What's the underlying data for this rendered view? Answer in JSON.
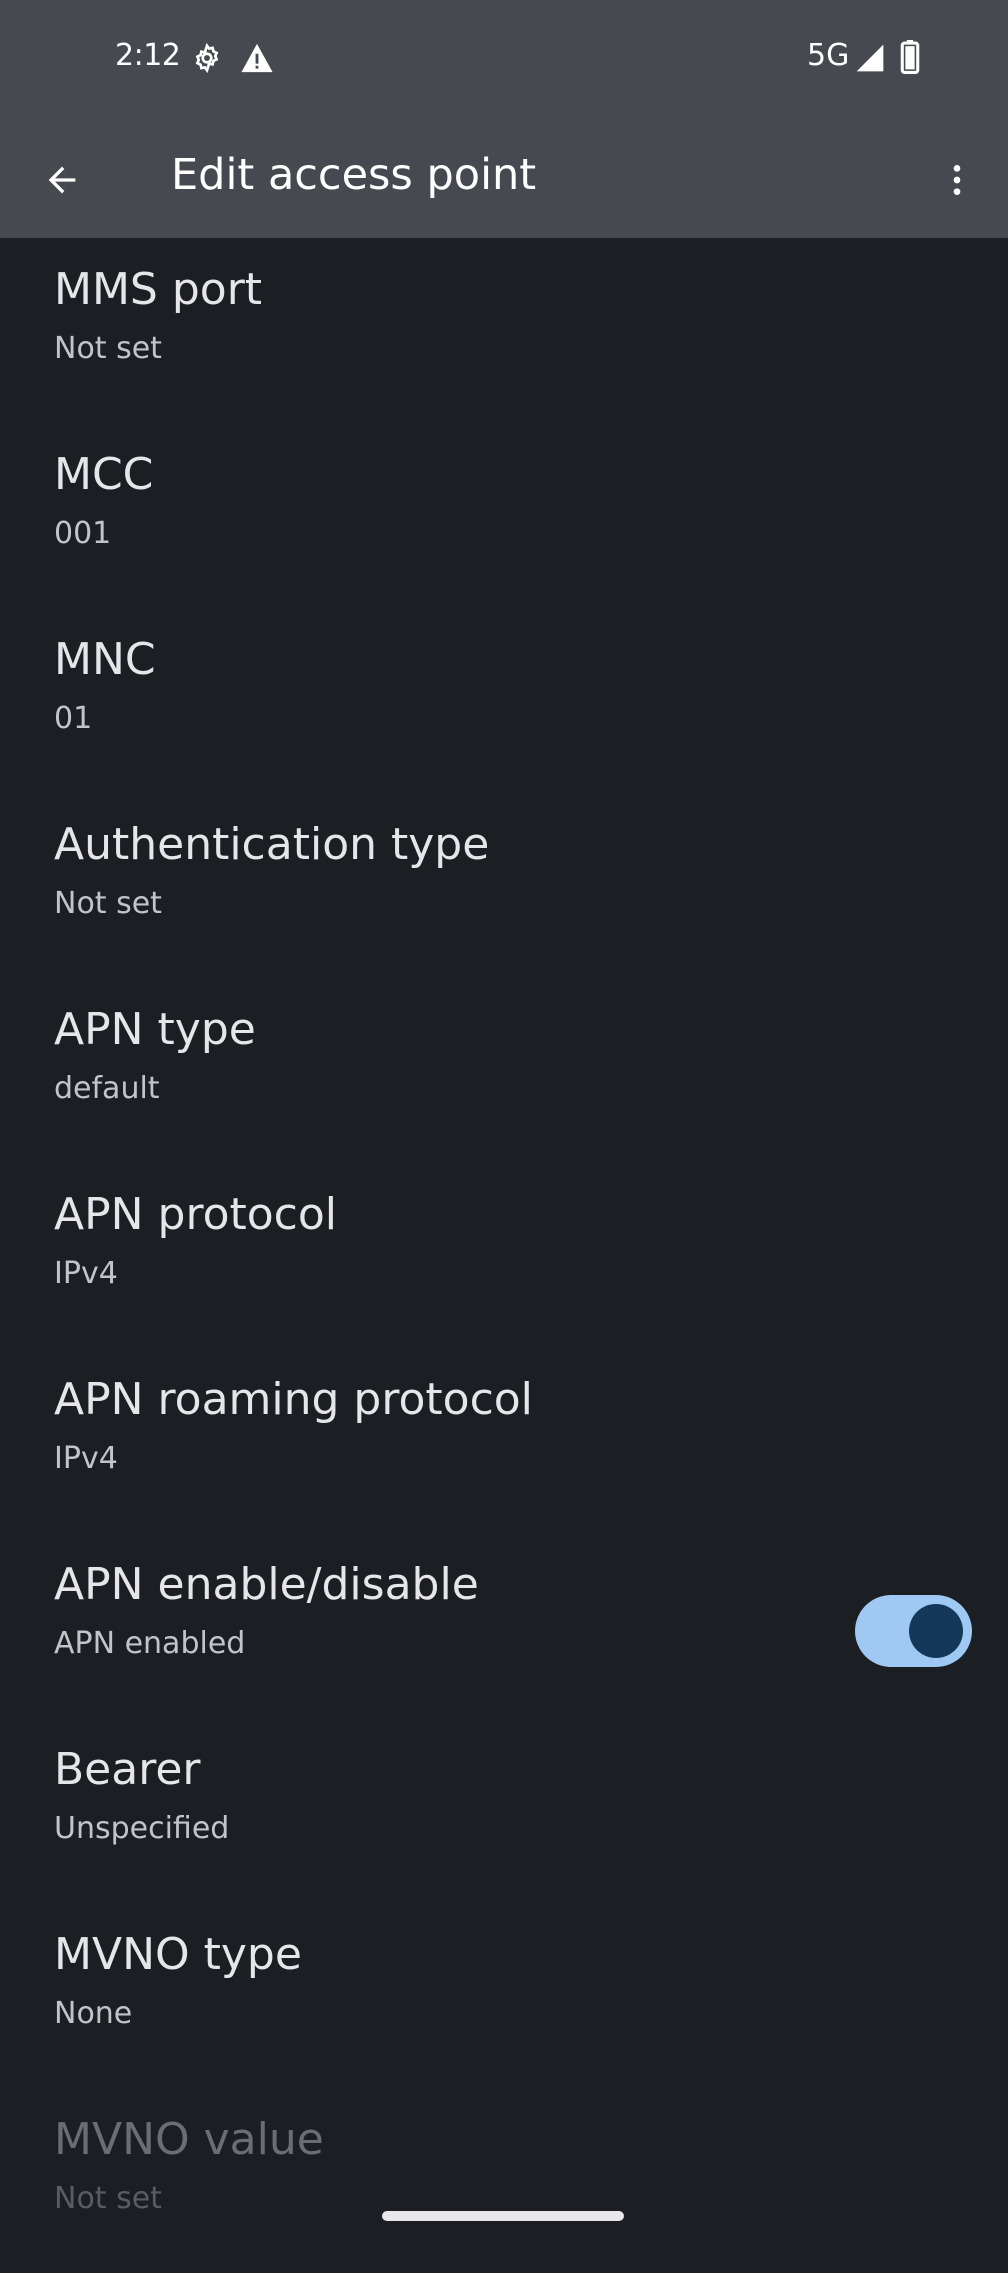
{
  "status_bar": {
    "time": "2:12",
    "network": "5G",
    "icons": [
      "settings-gear-icon",
      "warning-icon",
      "cell-signal-icon",
      "battery-icon"
    ]
  },
  "app_bar": {
    "title": "Edit access point",
    "back_icon": "arrow-back-icon",
    "more_icon": "more-vert-icon"
  },
  "preferences": [
    {
      "title": "MMS port",
      "summary": "Not set"
    },
    {
      "title": "MCC",
      "summary": "001"
    },
    {
      "title": "MNC",
      "summary": "01"
    },
    {
      "title": "Authentication type",
      "summary": "Not set"
    },
    {
      "title": "APN type",
      "summary": "default"
    },
    {
      "title": "APN protocol",
      "summary": "IPv4"
    },
    {
      "title": "APN roaming protocol",
      "summary": "IPv4"
    },
    {
      "title": "APN enable/disable",
      "summary": "APN enabled",
      "toggle_on": true
    },
    {
      "title": "Bearer",
      "summary": "Unspecified"
    },
    {
      "title": "MVNO type",
      "summary": "None"
    },
    {
      "title": "MVNO value",
      "summary": "Not set",
      "enabled": false
    }
  ],
  "colors": {
    "background": "#1b1e23",
    "app_bar": "#46494f",
    "toggle_track_on": "#9fc8f2",
    "toggle_thumb_on": "#143859"
  }
}
